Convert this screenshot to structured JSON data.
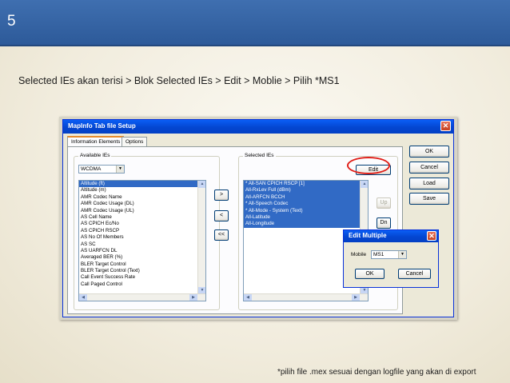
{
  "slide": {
    "number": "5",
    "instruction": "Selected IEs akan terisi > Blok Selected IEs > Edit > Moblie > Pilih *MS1",
    "footnote": "*pilih file .mex sesuai dengan logfile yang akan di export"
  },
  "dialog": {
    "title": "MapInfo Tab file Setup",
    "close_glyph": "✕",
    "tabs": [
      {
        "label": "Information Elements",
        "active": true
      },
      {
        "label": "Options",
        "active": false
      }
    ],
    "available_group_label": "Available IEs",
    "technology_value": "WCDMA",
    "available_items": [
      "Altitude (ft)",
      "Altitude (m)",
      "AMR Codec Name",
      "AMR Codec Usage (DL)",
      "AMR Codec Usage (UL)",
      "AS Cell Name",
      "AS CPICH Ec/No",
      "AS CPICH RSCP",
      "AS No Of Members",
      "AS SC",
      "AS UARFCN DL",
      "Averaged BER (%)",
      "BLER Target Control",
      "BLER Target Control (Text)",
      "Call Event Success Rate",
      "Call Paged Control"
    ],
    "selected_group_label": "Selected IEs",
    "selected_items": [
      "* All-SAN CPICH RSCP [1]",
      "All-RxLev Full (dBm)",
      "All-ARFCN BCCH",
      "* All-Speech Codec",
      "* All-Mode - System (Text)",
      "All-Latitude",
      "All-Longitude"
    ],
    "move_buttons": [
      ">",
      "<",
      "<<"
    ],
    "edit_label": "Edit",
    "up_label": "Up",
    "dn_label": "Dn",
    "side_buttons": [
      "OK",
      "Cancel",
      "Load",
      "Save"
    ]
  },
  "edit_multiple": {
    "title": "Edit Multiple",
    "close_glyph": "✕",
    "mobile_label": "Mobile",
    "mobile_value": "MS1",
    "ok_label": "OK",
    "cancel_label": "Cancel"
  },
  "colors": {
    "slide_header": "#3f6fb0",
    "titlebar": "#0446d1",
    "selection": "#316ac5",
    "highlight": "#e0201a"
  }
}
